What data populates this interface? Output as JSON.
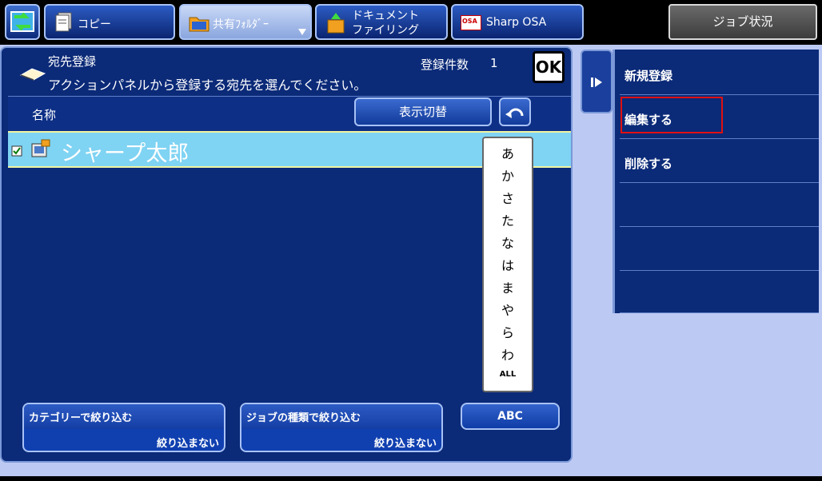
{
  "topbar": {
    "tabs": [
      {
        "label": "コピー"
      },
      {
        "label": "共有ﾌｫﾙﾀﾞｰ"
      },
      {
        "label_line1": "ドキュメント",
        "label_line2": "ファイリング"
      },
      {
        "label": "Sharp OSA",
        "badge": "OSA"
      }
    ],
    "job_status": "ジョブ状況"
  },
  "header": {
    "title": "宛先登録",
    "instruction": "アクションパネルから登録する宛先を選んでください。",
    "count_label": "登録件数",
    "count_value": "1",
    "ok": "OK"
  },
  "list": {
    "column_name": "名称",
    "toggle_display": "表示切替",
    "rows": [
      {
        "name": "シャープ太郎",
        "checked": true,
        "selected": true
      }
    ]
  },
  "kana_index": [
    "あ",
    "か",
    "さ",
    "た",
    "な",
    "は",
    "ま",
    "や",
    "ら",
    "わ",
    "ALL"
  ],
  "filters": {
    "category_title": "カテゴリーで絞り込む",
    "category_value": "絞り込まない",
    "jobtype_title": "ジョブの種類で絞り込む",
    "jobtype_value": "絞り込まない",
    "abc": "ABC"
  },
  "actions": {
    "items": [
      "新規登録",
      "編集する",
      "削除する",
      "",
      "",
      ""
    ],
    "highlighted": "編集する"
  },
  "colors": {
    "panel": "#0b2a78",
    "selected_row": "#7fd3f3",
    "highlight": "#e01010"
  }
}
